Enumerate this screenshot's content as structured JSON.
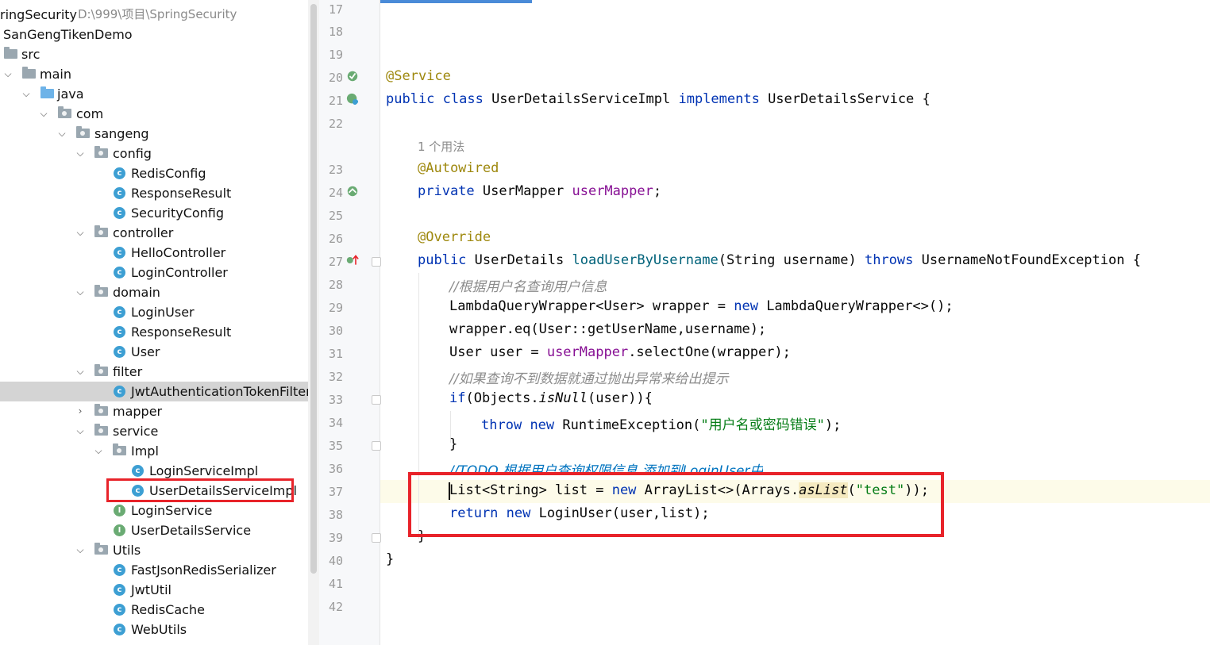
{
  "project_tree": {
    "root": {
      "name": "ringSecurity",
      "path": "D:\\999\\项目\\SpringSecurity"
    },
    "items": [
      {
        "label": "SanGengTikenDemo",
        "type": "module"
      },
      {
        "label": "src",
        "type": "folder"
      },
      {
        "label": "main",
        "type": "folder"
      },
      {
        "label": "java",
        "type": "source-folder"
      },
      {
        "label": "com",
        "type": "package"
      },
      {
        "label": "sangeng",
        "type": "package"
      },
      {
        "label": "config",
        "type": "package"
      },
      {
        "label": "RedisConfig",
        "type": "class"
      },
      {
        "label": "ResponseResult",
        "type": "class"
      },
      {
        "label": "SecurityConfig",
        "type": "class"
      },
      {
        "label": "controller",
        "type": "package"
      },
      {
        "label": "HelloController",
        "type": "class"
      },
      {
        "label": "LoginController",
        "type": "class"
      },
      {
        "label": "domain",
        "type": "package"
      },
      {
        "label": "LoginUser",
        "type": "class"
      },
      {
        "label": "ResponseResult",
        "type": "class"
      },
      {
        "label": "User",
        "type": "class"
      },
      {
        "label": "filter",
        "type": "package"
      },
      {
        "label": "JwtAuthenticationTokenFilter",
        "type": "class",
        "selected": true
      },
      {
        "label": "mapper",
        "type": "package"
      },
      {
        "label": "service",
        "type": "package"
      },
      {
        "label": "Impl",
        "type": "package"
      },
      {
        "label": "LoginServiceImpl",
        "type": "class"
      },
      {
        "label": "UserDetailsServiceImpl",
        "type": "class",
        "highlighted": true
      },
      {
        "label": "LoginService",
        "type": "interface"
      },
      {
        "label": "UserDetailsService",
        "type": "interface"
      },
      {
        "label": "Utils",
        "type": "package"
      },
      {
        "label": "FastJsonRedisSerializer",
        "type": "class"
      },
      {
        "label": "JwtUtil",
        "type": "class"
      },
      {
        "label": "RedisCache",
        "type": "class"
      },
      {
        "label": "WebUtils",
        "type": "class"
      }
    ]
  },
  "editor": {
    "line_numbers": [
      "17",
      "18",
      "19",
      "20",
      "21",
      "22",
      "23",
      "24",
      "25",
      "26",
      "27",
      "28",
      "29",
      "30",
      "31",
      "32",
      "33",
      "34",
      "35",
      "36",
      "37",
      "38",
      "39",
      "40",
      "41",
      "42"
    ],
    "usage_hint": "1 个用法",
    "code": {
      "l20": "@Service",
      "l21_kw1": "public class",
      "l21_name": " UserDetailsServiceImpl ",
      "l21_kw2": "implements",
      "l21_rest": " UserDetailsService {",
      "l23": "@Autowired",
      "l24_kw": "private",
      "l24_type": " UserMapper ",
      "l24_field": "userMapper",
      "l24_end": ";",
      "l26": "@Override",
      "l27_kw": "public",
      "l27_type": " UserDetails ",
      "l27_method": "loadUserByUsername",
      "l27_params": "(String username) ",
      "l27_throws": "throws",
      "l27_rest": " UsernameNotFoundException {",
      "l28": "//根据用户名查询用户信息",
      "l29_a": "LambdaQueryWrapper<User> wrapper = ",
      "l29_new": "new",
      "l29_b": " LambdaQueryWrapper<>();",
      "l30": "wrapper.eq(User::getUserName,username);",
      "l31_a": "User user = ",
      "l31_field": "userMapper",
      "l31_b": ".selectOne(wrapper);",
      "l32": "//如果查询不到数据就通过抛出异常来给出提示",
      "l33_kw": "if",
      "l33_a": "(Objects.",
      "l33_m": "isNull",
      "l33_b": "(user)){",
      "l34_kw1": "throw",
      "l34_kw2": "new",
      "l34_a": " RuntimeException(",
      "l34_str": "\"用户名或密码错误\"",
      "l34_b": ");",
      "l35": "}",
      "l36": "//TODO 根据用户查询权限信息 添加到LoginUser中",
      "l37_a": "List<String> list = ",
      "l37_new": "new",
      "l37_b": " ArrayList<>(Arrays.",
      "l37_m": "asList",
      "l37_c": "(",
      "l37_str": "\"test\"",
      "l37_d": "));",
      "l38_kw1": "return",
      "l38_kw2": "new",
      "l38_a": " LoginUser(user,list);",
      "l39": "}",
      "l40": "}"
    }
  },
  "colors": {
    "highlight_box": "#e8232a",
    "selection": "#d4d4d4"
  }
}
